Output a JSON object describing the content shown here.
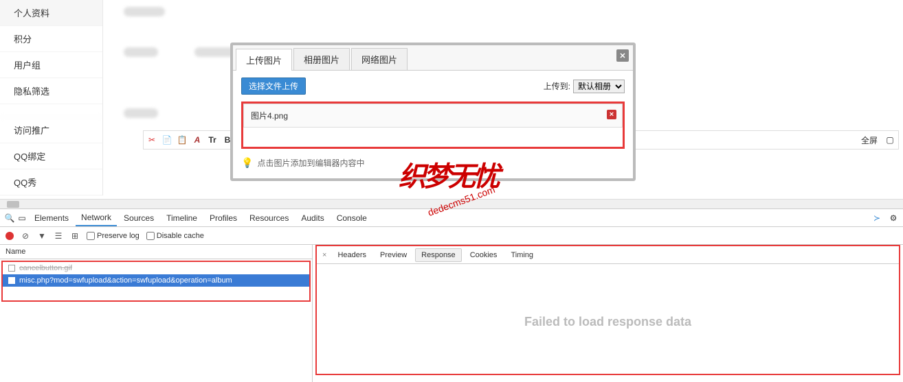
{
  "sidebar": {
    "items": [
      {
        "label": "个人资料"
      },
      {
        "label": "积分"
      },
      {
        "label": "用户组"
      },
      {
        "label": "隐私筛选"
      },
      {
        "label": ""
      },
      {
        "label": "访问推广"
      },
      {
        "label": "QQ绑定"
      },
      {
        "label": "QQ秀"
      }
    ]
  },
  "editor": {
    "fullscreen": "全屏"
  },
  "modal": {
    "tabs": [
      "上传图片",
      "相册图片",
      "网络图片"
    ],
    "upload_button": "选择文件上传",
    "upload_to_label": "上传到:",
    "album_select": "默认相册",
    "file_name": "图片4.png",
    "hint": "点击图片添加到编辑器内容中"
  },
  "watermark": {
    "chars": "织梦无忧",
    "url": "dedecms51.com"
  },
  "devtools": {
    "tabs": [
      "Elements",
      "Network",
      "Sources",
      "Timeline",
      "Profiles",
      "Resources",
      "Audits",
      "Console"
    ],
    "active_tab": "Network",
    "preserve_log": "Preserve log",
    "disable_cache": "Disable cache",
    "name_header": "Name",
    "requests": [
      {
        "name": "cancelbutton.gif",
        "cancelled": true
      },
      {
        "name": "misc.php?mod=swfupload&action=swfupload&operation=album",
        "selected": true
      }
    ],
    "detail_tabs": [
      "Headers",
      "Preview",
      "Response",
      "Cookies",
      "Timing"
    ],
    "active_detail": "Response",
    "fail_message": "Failed to load response data"
  }
}
